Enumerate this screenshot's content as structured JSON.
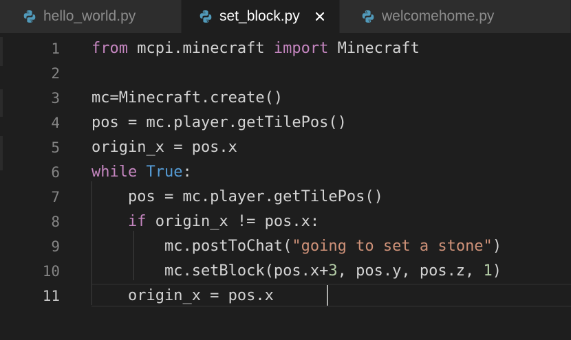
{
  "tabs": [
    {
      "label": "hello_world.py",
      "icon": "python-icon",
      "active": false
    },
    {
      "label": "set_block.py",
      "icon": "python-icon",
      "active": true,
      "close_glyph": "✕"
    },
    {
      "label": "welcomehome.py",
      "icon": "python-icon",
      "active": false
    }
  ],
  "editor": {
    "line_numbers": [
      "1",
      "2",
      "3",
      "4",
      "5",
      "6",
      "7",
      "8",
      "9",
      "10",
      "11"
    ],
    "current_line": "11",
    "lines": [
      {
        "tokens": [
          [
            "kw",
            "from"
          ],
          [
            "",
            " mcpi.minecraft "
          ],
          [
            "kw",
            "import"
          ],
          [
            "",
            " Minecraft"
          ]
        ]
      },
      {
        "tokens": []
      },
      {
        "tokens": [
          [
            "",
            "mc=Minecraft.create()"
          ]
        ]
      },
      {
        "tokens": [
          [
            "",
            "pos = mc.player.getTilePos()"
          ]
        ]
      },
      {
        "tokens": [
          [
            "",
            "origin_x = pos.x"
          ]
        ]
      },
      {
        "tokens": [
          [
            "kw",
            "while"
          ],
          [
            "",
            " "
          ],
          [
            "bi",
            "True"
          ],
          [
            "",
            ":"
          ]
        ]
      },
      {
        "tokens": [
          [
            "",
            "    pos = mc.player.getTilePos()"
          ]
        ]
      },
      {
        "tokens": [
          [
            "",
            "    "
          ],
          [
            "kw",
            "if"
          ],
          [
            "",
            " origin_x != pos.x:"
          ]
        ]
      },
      {
        "tokens": [
          [
            "",
            "        mc.postToChat("
          ],
          [
            "str",
            "\"going to set a stone\""
          ],
          [
            "",
            ")"
          ]
        ]
      },
      {
        "tokens": [
          [
            "",
            "        mc.setBlock(pos.x+"
          ],
          [
            "num",
            "3"
          ],
          [
            "",
            ", pos.y, pos.z, "
          ],
          [
            "num",
            "1"
          ],
          [
            "",
            ")"
          ]
        ]
      },
      {
        "tokens": [
          [
            "",
            "    origin_x = pos.x"
          ]
        ]
      }
    ]
  },
  "colors": {
    "background": "#1e1e1e",
    "tab_bar": "#252526",
    "inactive_tab": "#2d2d2d",
    "keyword": "#c586c0",
    "builtin": "#569cd6",
    "string": "#ce9178",
    "number": "#b5cea8",
    "text": "#d4d4d4",
    "python_icon_blue": "#519aba"
  }
}
